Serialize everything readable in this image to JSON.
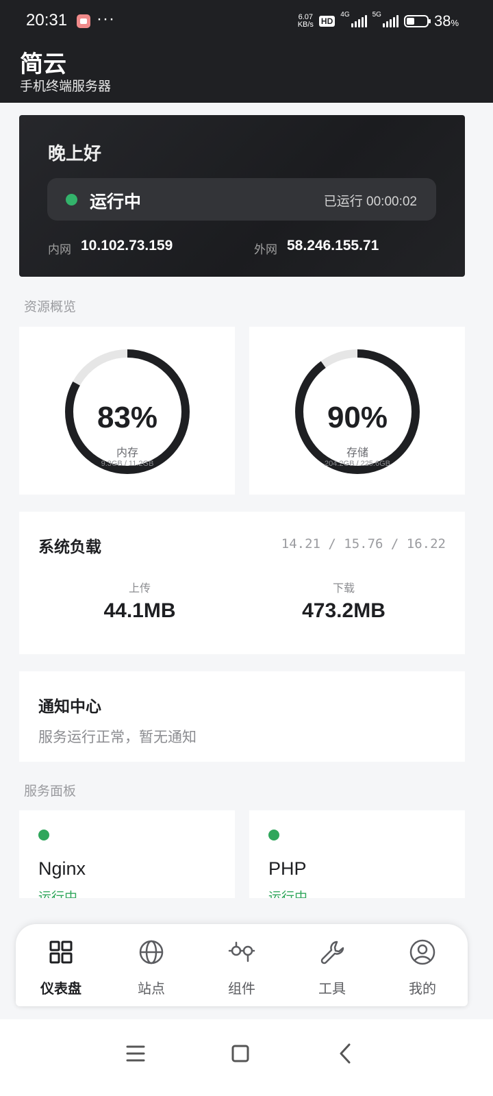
{
  "status_bar": {
    "time": "20:31",
    "more": "···",
    "speed_value": "6.07",
    "speed_unit": "KB/s",
    "hd_badge": "HD",
    "net1": "4G",
    "net2": "5G",
    "battery_percent": "38",
    "battery_unit": "%",
    "battery_level": 0.38
  },
  "header": {
    "title": "简云",
    "subtitle": "手机终端服务器"
  },
  "hero": {
    "greeting": "晚上好",
    "status": "运行中",
    "uptime": "已运行 00:00:02",
    "lan_label": "内网",
    "lan_ip": "10.102.73.159",
    "wan_label": "外网",
    "wan_ip": "58.246.155.71"
  },
  "resources": {
    "section_label": "资源概览",
    "memory": {
      "percent_text": "83%",
      "percent": 0.83,
      "name": "内存",
      "detail": "9.3GB / 11.2GB"
    },
    "storage": {
      "percent_text": "90%",
      "percent": 0.9,
      "name": "存储",
      "detail": "204.2GB / 225.6GB"
    }
  },
  "load": {
    "title": "系统负载",
    "averages": "14.21 / 15.76 / 16.22",
    "upload_label": "上传",
    "upload_value": "44.1MB",
    "download_label": "下载",
    "download_value": "473.2MB"
  },
  "notice": {
    "title": "通知中心",
    "text": "服务运行正常，暂无通知"
  },
  "services": {
    "section_label": "服务面板",
    "items": [
      {
        "name": "Nginx",
        "status": "运行中"
      },
      {
        "name": "PHP",
        "status": "运行中"
      }
    ]
  },
  "bottom_nav": {
    "items": [
      {
        "label": "仪表盘",
        "icon": "dashboard-icon"
      },
      {
        "label": "站点",
        "icon": "globe-icon"
      },
      {
        "label": "组件",
        "icon": "components-icon"
      },
      {
        "label": "工具",
        "icon": "wrench-icon"
      },
      {
        "label": "我的",
        "icon": "profile-icon"
      }
    ]
  },
  "colors": {
    "header_bg": "#1f2023",
    "running_green": "#33b36b",
    "gauge_fill": "#1e1f22",
    "gauge_track": "#e6e6e6"
  }
}
